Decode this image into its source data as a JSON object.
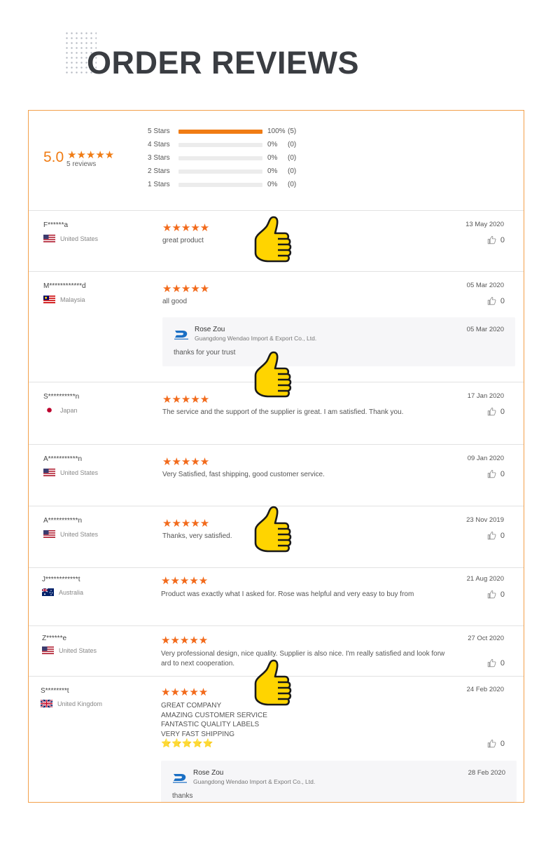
{
  "header": {
    "title": "ORDER REVIEWS"
  },
  "summary": {
    "score": "5.0",
    "stars": "★★★★★",
    "review_count": "5 reviews",
    "breakdown": [
      {
        "label": "5 Stars",
        "fill": 1.0,
        "percent": "100%",
        "count": "(5)"
      },
      {
        "label": "4 Stars",
        "fill": 0.0,
        "percent": "0%",
        "count": "(0)"
      },
      {
        "label": "3 Stars",
        "fill": 0.0,
        "percent": "0%",
        "count": "(0)"
      },
      {
        "label": "2 Stars",
        "fill": 0.0,
        "percent": "0%",
        "count": "(0)"
      },
      {
        "label": "1 Stars",
        "fill": 0.0,
        "percent": "0%",
        "count": "(0)"
      }
    ]
  },
  "reviews": [
    {
      "name": "F******a",
      "country": "United States",
      "flag": "us",
      "stars": "★★★★★",
      "text": "great product",
      "date": "13 May 2020",
      "likes": "0"
    },
    {
      "name": "M************d",
      "country": "Malaysia",
      "flag": "my",
      "stars": "★★★★★",
      "text": "all good",
      "date": "05 Mar 2020",
      "likes": "0",
      "reply": {
        "name": "Rose Zou",
        "company": "Guangdong Wendao Import & Export Co., Ltd.",
        "date": "05 Mar 2020",
        "text": "thanks for your trust"
      }
    },
    {
      "name": "S**********n",
      "country": "Japan",
      "flag": "jp",
      "stars": "★★★★★",
      "text": "The service and the support of the supplier is great. I am satisfied. Thank you.",
      "date": "17 Jan 2020",
      "likes": "0"
    },
    {
      "name": "A***********n",
      "country": "United States",
      "flag": "us",
      "stars": "★★★★★",
      "text": "Very Satisfied, fast shipping, good customer service.",
      "date": "09 Jan 2020",
      "likes": "0"
    },
    {
      "name": "A***********n",
      "country": "United States",
      "flag": "us",
      "stars": "★★★★★",
      "text": "Thanks, very satisfied.",
      "date": "23 Nov 2019",
      "likes": "0"
    },
    {
      "name": "J************t",
      "country": "Australia",
      "flag": "au",
      "stars": "★★★★★",
      "text": "Product was exactly what I asked for. Rose was helpful and very easy to buy from",
      "date": "21 Aug 2020",
      "likes": "0"
    },
    {
      "name": "Z******e",
      "country": "United States",
      "flag": "us",
      "stars": "★★★★★",
      "text_lines": [
        "Very professional design, nice quality. Supplier is also nice. I'm really satisfied and look forw",
        "ard to next cooperation."
      ],
      "date": "27 Oct 2020",
      "likes": "0"
    },
    {
      "name": "S********t",
      "country": "United Kingdom",
      "flag": "uk",
      "stars": "★★★★★",
      "text_lines": [
        "GREAT COMPANY",
        "AMAZING CUSTOMER SERVICE",
        "FANTASTIC QUALITY LABELS",
        "VERY FAST SHIPPING",
        "⭐⭐⭐⭐⭐"
      ],
      "date": "24 Feb 2020",
      "likes": "0",
      "reply": {
        "name": "Rose Zou",
        "company": "Guangdong Wendao Import & Export Co., Ltd.",
        "date": "28 Feb 2020",
        "text": "thanks"
      }
    }
  ],
  "colors": {
    "accent": "#f07c14",
    "star": "#f26a1b",
    "border": "#f3a04a",
    "thumb": "#ffd400"
  },
  "icons": [
    "thumbs-up-icon",
    "like-icon",
    "flag-icon",
    "supplier-logo-icon"
  ]
}
